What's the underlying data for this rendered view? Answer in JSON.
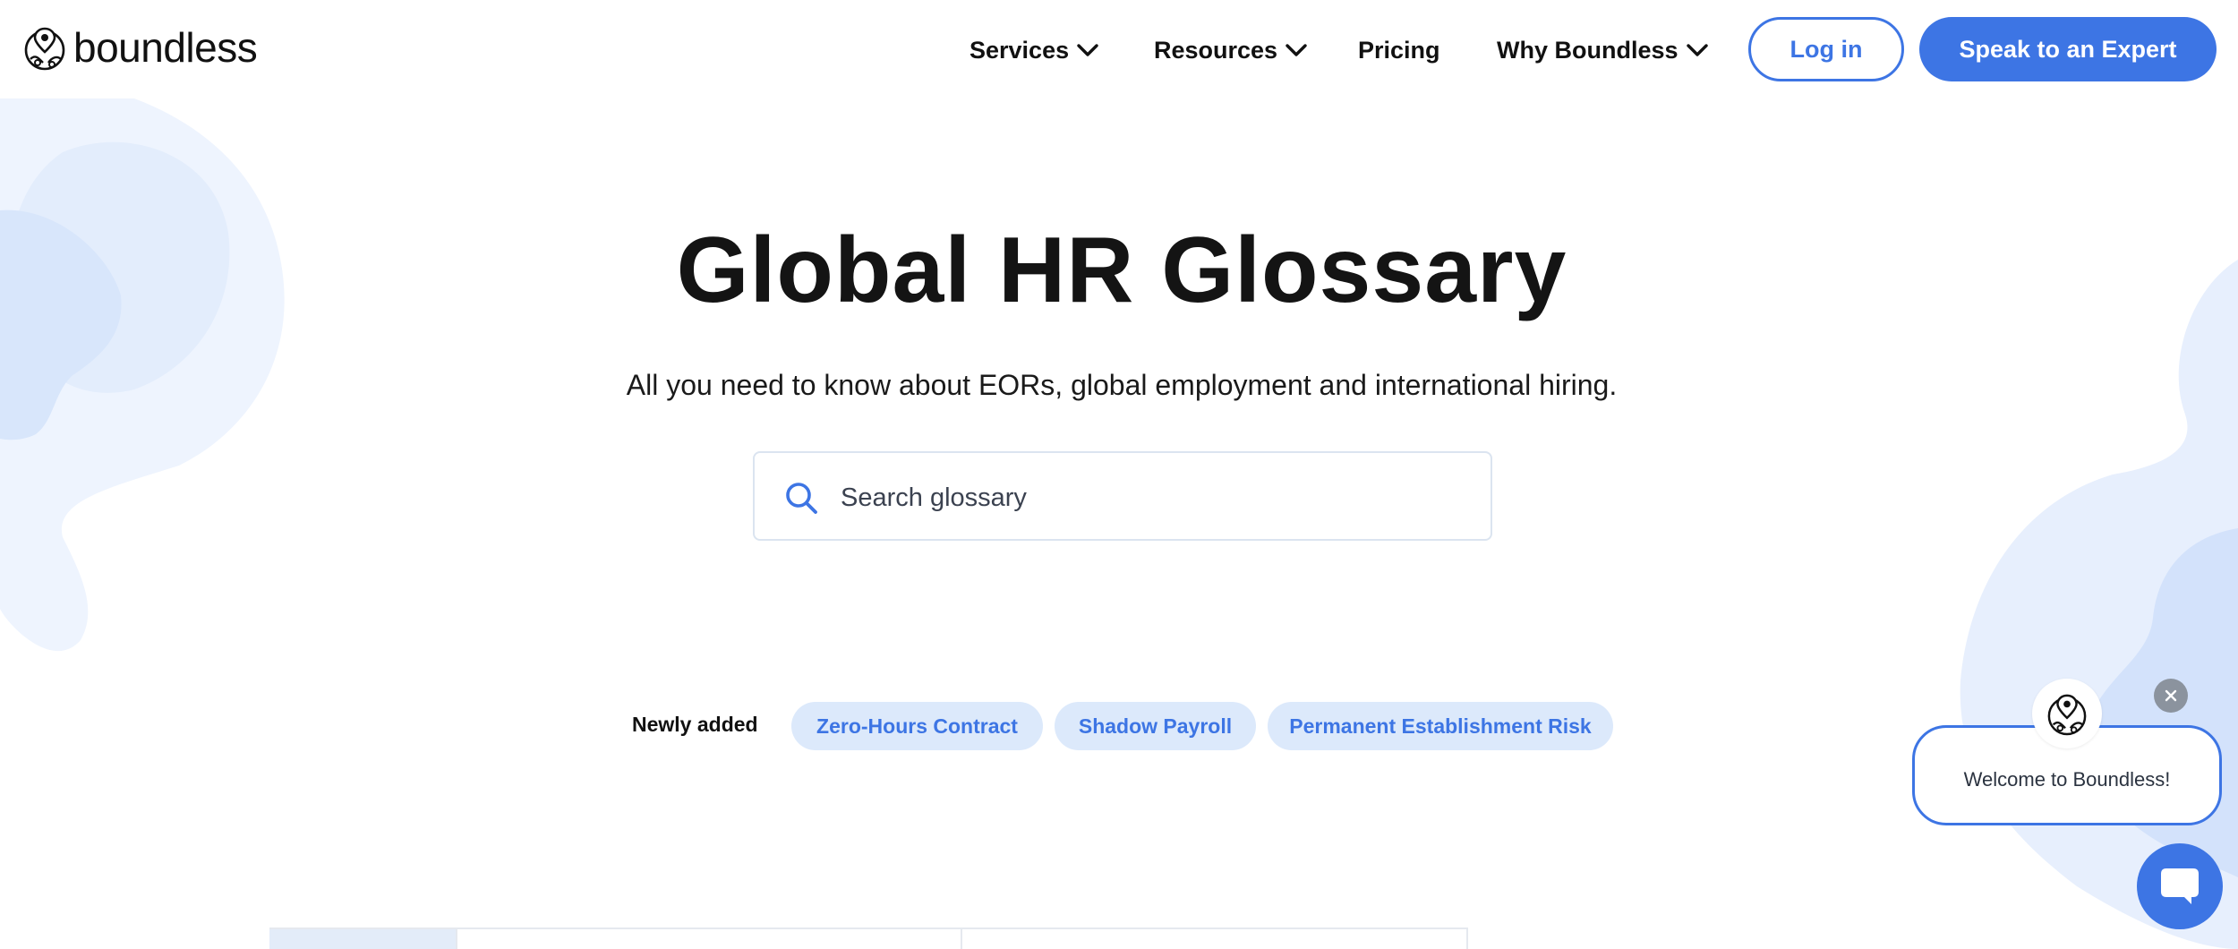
{
  "header": {
    "logo_text": "boundless",
    "nav": [
      {
        "label": "Services",
        "has_dropdown": true
      },
      {
        "label": "Resources",
        "has_dropdown": true
      },
      {
        "label": "Pricing",
        "has_dropdown": false
      },
      {
        "label": "Why Boundless",
        "has_dropdown": true
      }
    ],
    "login_label": "Log in",
    "cta_label": "Speak to an Expert"
  },
  "hero": {
    "title": "Global HR Glossary",
    "subtitle": "All you need to know about EORs, global employment and international hiring.",
    "search": {
      "placeholder": "Search glossary",
      "value": ""
    }
  },
  "newly_added": {
    "label": "Newly added",
    "chips": [
      "Zero-Hours Contract",
      "Shadow Payroll",
      "Permanent Establishment Risk"
    ]
  },
  "chat": {
    "welcome": "Welcome to Boundless!"
  },
  "colors": {
    "brand_blue": "#3d75e4",
    "chip_bg": "#dce9fb",
    "blob_light": "#eaf1fd",
    "blob_mid": "#d6e4fb"
  },
  "icons": {
    "logo": "globe-logo-icon",
    "dropdown": "chevron-down-icon",
    "search": "search-icon",
    "close": "close-icon",
    "chat": "chat-icon"
  }
}
